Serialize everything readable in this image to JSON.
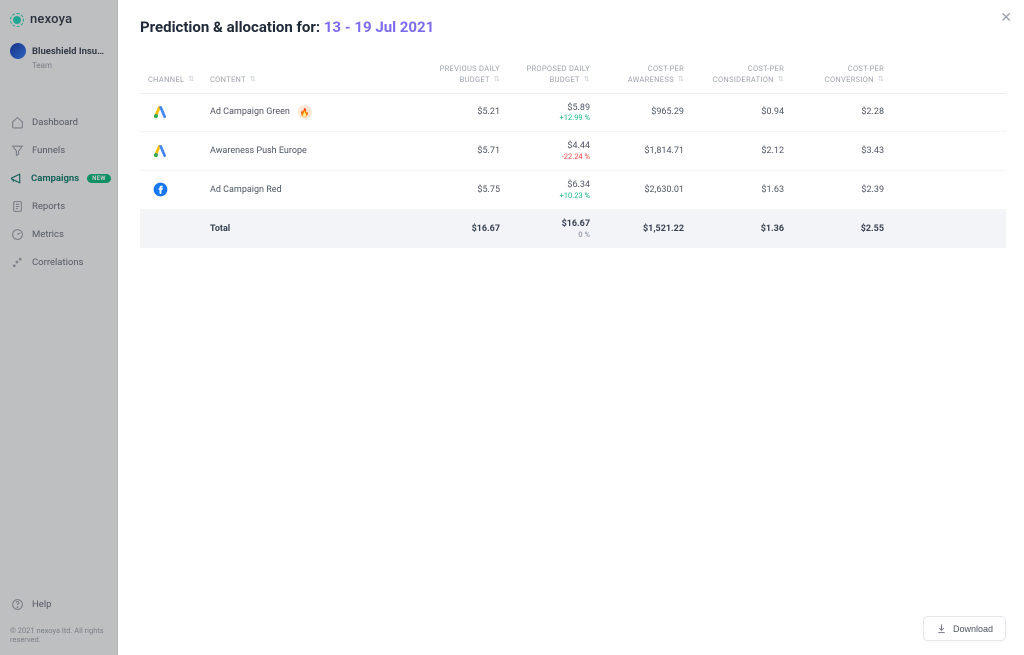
{
  "brand": {
    "name": "nexoya"
  },
  "org": {
    "name": "Blueshield Insuran…",
    "plan": "Team"
  },
  "nav": {
    "dashboard": "Dashboard",
    "funnels": "Funnels",
    "campaigns": "Campaigns",
    "campaigns_badge": "NEW",
    "reports": "Reports",
    "metrics": "Metrics",
    "correlations": "Correlations"
  },
  "footer": {
    "help": "Help",
    "copyright": "© 2021 nexoya ltd. All rights reserved."
  },
  "header": {
    "title_prefix": "Prediction & allocation for: ",
    "date_range": "13 - 19 Jul 2021"
  },
  "columns": {
    "channel": "CHANNEL",
    "content": "CONTENT",
    "prev1": "PREVIOUS DAILY",
    "prev2": "BUDGET",
    "prop1": "PROPOSED DAILY",
    "prop2": "BUDGET",
    "cpa1": "COST-PER",
    "cpa2": "AWARENESS",
    "cpc1": "COST-PER",
    "cpc2": "CONSIDERATION",
    "cpv1": "COST-PER",
    "cpv2": "CONVERSION"
  },
  "rows": [
    {
      "channel": "google-ads",
      "content": "Ad Campaign Green",
      "hot": true,
      "prev": "$5.21",
      "prop": "$5.89",
      "delta": "+12.99 %",
      "dclass": "pos",
      "awareness": "$965.29",
      "consideration": "$0.94",
      "conversion": "$2.28"
    },
    {
      "channel": "google-ads",
      "content": "Awareness Push Europe",
      "hot": false,
      "prev": "$5.71",
      "prop": "$4.44",
      "delta": "-22.24 %",
      "dclass": "neg",
      "awareness": "$1,814.71",
      "consideration": "$2.12",
      "conversion": "$3.43"
    },
    {
      "channel": "facebook",
      "content": "Ad Campaign Red",
      "hot": false,
      "prev": "$5.75",
      "prop": "$6.34",
      "delta": "+10.23 %",
      "dclass": "pos",
      "awareness": "$2,630.01",
      "consideration": "$1.63",
      "conversion": "$2.39"
    }
  ],
  "total": {
    "label": "Total",
    "prev": "$16.67",
    "prop": "$16.67",
    "delta": "0 %",
    "awareness": "$1,521.22",
    "consideration": "$1.36",
    "conversion": "$2.55"
  },
  "download": "Download"
}
